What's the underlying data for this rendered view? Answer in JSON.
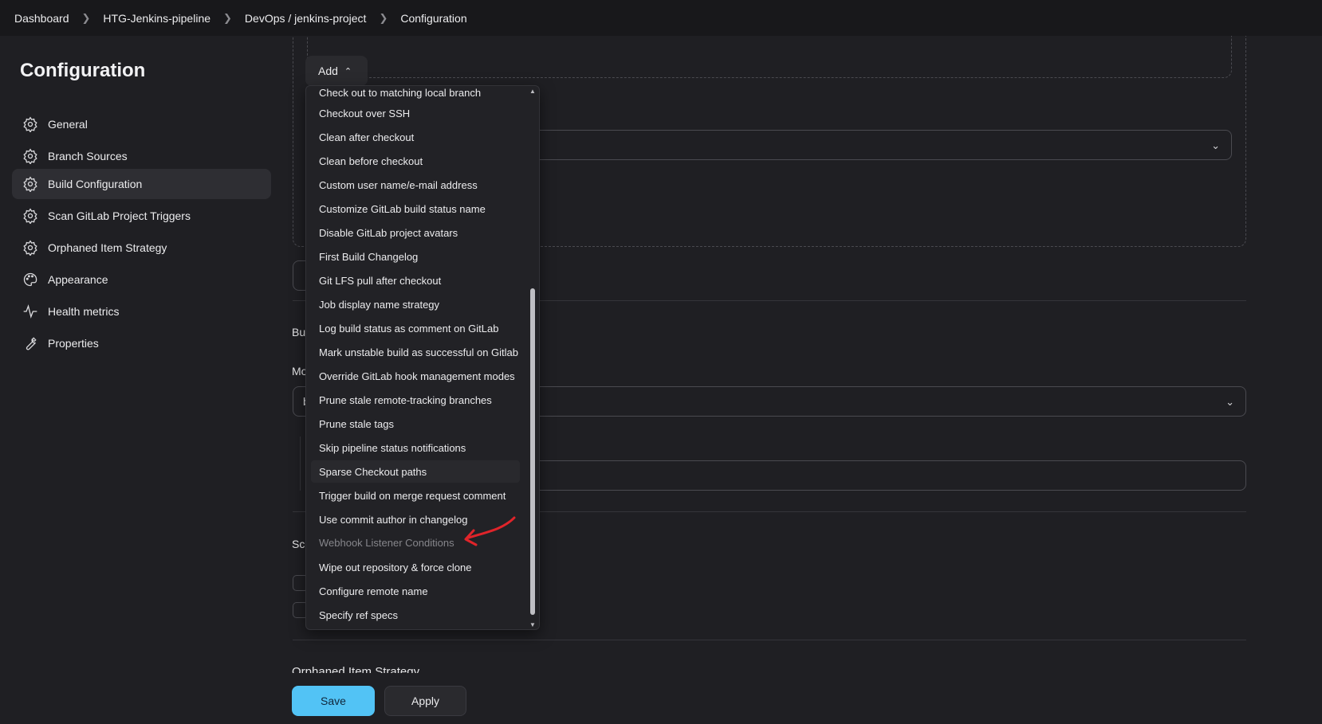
{
  "breadcrumb": [
    "Dashboard",
    "HTG-Jenkins-pipeline",
    "DevOps / jenkins-project",
    "Configuration"
  ],
  "sidebar": {
    "title": "Configuration",
    "items": [
      {
        "label": "General",
        "icon": "gear-icon"
      },
      {
        "label": "Branch Sources",
        "icon": "gear-icon"
      },
      {
        "label": "Build Configuration",
        "icon": "gear-icon",
        "active": true
      },
      {
        "label": "Scan GitLab Project Triggers",
        "icon": "gear-icon"
      },
      {
        "label": "Orphaned Item Strategy",
        "icon": "gear-icon"
      },
      {
        "label": "Appearance",
        "icon": "palette-icon"
      },
      {
        "label": "Health metrics",
        "icon": "pulse-icon"
      },
      {
        "label": "Properties",
        "icon": "wrench-icon"
      }
    ]
  },
  "main": {
    "add_button": "Add",
    "partial_labels": [
      "Bu",
      "Mo",
      "b",
      "Sca"
    ],
    "section_heading_partial": "Orphaned Item Strategy"
  },
  "dropdown": {
    "items": [
      "Check out to matching local branch",
      "Checkout over SSH",
      "Clean after checkout",
      "Clean before checkout",
      "Custom user name/e-mail address",
      "Customize GitLab build status name",
      "Disable GitLab project avatars",
      "First Build Changelog",
      "Git LFS pull after checkout",
      "Job display name strategy",
      "Log build status as comment on GitLab",
      "Mark unstable build as successful on Gitlab",
      "Override GitLab hook management modes",
      "Prune stale remote-tracking branches",
      "Prune stale tags",
      "Skip pipeline status notifications",
      "Sparse Checkout paths",
      "Trigger build on merge request comment",
      "Use commit author in changelog",
      "Webhook Listener Conditions",
      "Wipe out repository & force clone",
      "Configure remote name",
      "Specify ref specs"
    ],
    "hovered_item": "Sparse Checkout paths",
    "disabled_item": "Webhook Listener Conditions"
  },
  "footer": {
    "save": "Save",
    "apply": "Apply"
  },
  "colors": {
    "accent": "#52c3f5",
    "annotation": "#e0242a",
    "background": "#1f1f23"
  }
}
